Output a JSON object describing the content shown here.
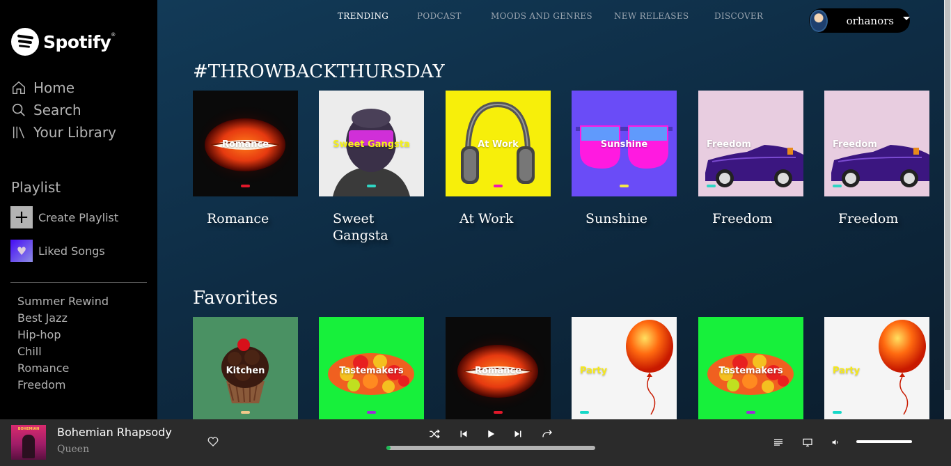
{
  "app": {
    "brand": "Spotify",
    "accent_color": "#1db954"
  },
  "sidebar": {
    "nav": [
      {
        "label": "Home",
        "icon": "home-icon"
      },
      {
        "label": "Search",
        "icon": "search-icon"
      },
      {
        "label": "Your Library",
        "icon": "library-icon"
      }
    ],
    "playlist_section_title": "Playlist",
    "create_playlist_label": "Create Playlist",
    "liked_songs_label": "Liked Songs",
    "playlists": [
      "Summer Rewind",
      "Best Jazz",
      "Hip-hop",
      "Chill",
      "Romance",
      "Freedom"
    ]
  },
  "topnav": {
    "tabs": [
      "TRENDING",
      "PODCAST",
      "MOODS AND GENRES",
      "NEW RELEASES",
      "DISCOVER"
    ],
    "active_tab": "TRENDING",
    "username": "orhanors"
  },
  "sections": [
    {
      "title": "#THROWBACKTHURSDAY",
      "cards": [
        {
          "cover_text": "Romance",
          "title": "Romance",
          "bg": "#0a0a0a",
          "dash_color": "#e0182a",
          "art": "lips"
        },
        {
          "cover_text": "Sweet Gangsta",
          "title": "Sweet Gangsta",
          "bg": "#f2f2f2",
          "dash_color": "#2fd6c4",
          "art": "masked-person",
          "text_color": "#f5f21a"
        },
        {
          "cover_text": "At Work",
          "title": "At Work",
          "bg": "#f7ef0a",
          "dash_color": "#f016b4",
          "art": "headphones"
        },
        {
          "cover_text": "Sunshine",
          "title": "Sunshine",
          "bg": "#6a4cf7",
          "dash_color": "#f5e84a",
          "art": "sunglasses"
        },
        {
          "cover_text": "Freedom",
          "title": "Freedom",
          "bg": "#e8cde0",
          "dash_color": "#2fd6c4",
          "art": "car"
        },
        {
          "cover_text": "Freedom",
          "title": "Freedom",
          "bg": "#e8cde0",
          "dash_color": "#2fd6c4",
          "art": "car"
        }
      ]
    },
    {
      "title": "Favorites",
      "cards": [
        {
          "cover_text": "Kitchen",
          "title": "",
          "bg": "#4a9163",
          "dash_color": "#f2c88a",
          "art": "cupcake"
        },
        {
          "cover_text": "Tastemakers",
          "title": "",
          "bg": "#17f03b",
          "dash_color": "#9b2fd6",
          "art": "candy"
        },
        {
          "cover_text": "Romance",
          "title": "",
          "bg": "#0a0a0a",
          "dash_color": "#e0182a",
          "art": "lips"
        },
        {
          "cover_text": "Party",
          "title": "",
          "bg": "#f5f5f5",
          "dash_color": "#17d8c8",
          "art": "balloon",
          "text_color": "#f5e81a"
        },
        {
          "cover_text": "Tastemakers",
          "title": "",
          "bg": "#17f03b",
          "dash_color": "#9b2fd6",
          "art": "candy"
        },
        {
          "cover_text": "Party",
          "title": "",
          "bg": "#f5f5f5",
          "dash_color": "#17d8c8",
          "art": "balloon",
          "text_color": "#f5e81a"
        }
      ]
    }
  ],
  "player": {
    "track_title": "Bohemian Rhapsody",
    "artist": "Queen",
    "progress": 0.02,
    "volume": 1.0,
    "controls": [
      "shuffle-icon",
      "previous-icon",
      "play-icon",
      "next-icon",
      "repeat-icon"
    ],
    "right_controls": [
      "queue-icon",
      "devices-icon",
      "volume-icon"
    ]
  }
}
